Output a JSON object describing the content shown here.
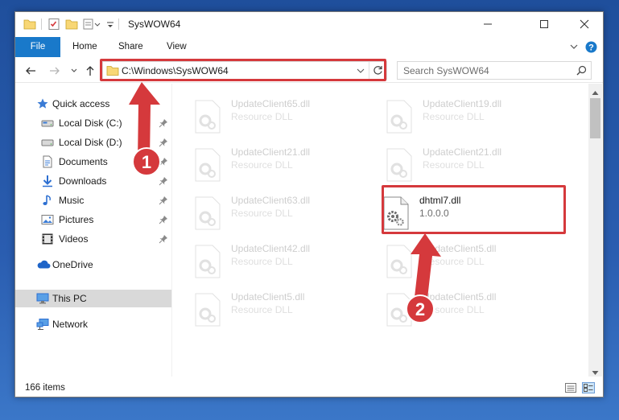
{
  "window": {
    "title": "SysWOW64",
    "minimize_glyph": "—",
    "maximize_glyph": "☐",
    "close_glyph": "✕"
  },
  "ribbon": {
    "tabs": [
      "File",
      "Home",
      "Share",
      "View"
    ],
    "expand_glyph": "⌄",
    "help_glyph": "?"
  },
  "address": {
    "path": "C:\\Windows\\SysWOW64",
    "search_placeholder": "Search SysWOW64"
  },
  "nav": {
    "items": [
      {
        "label": "Quick access",
        "icon": "star-icon"
      },
      {
        "label": "Local Disk (C:)",
        "icon": "drive-icon"
      },
      {
        "label": "Local Disk (D:)",
        "icon": "drive-icon"
      },
      {
        "label": "Documents",
        "icon": "documents-icon"
      },
      {
        "label": "Downloads",
        "icon": "download-icon"
      },
      {
        "label": "Music",
        "icon": "music-icon"
      },
      {
        "label": "Pictures",
        "icon": "pictures-icon"
      },
      {
        "label": "Videos",
        "icon": "videos-icon"
      },
      {
        "label": "OneDrive",
        "icon": "cloud-icon"
      },
      {
        "label": "This PC",
        "icon": "computer-icon"
      },
      {
        "label": "Network",
        "icon": "network-icon"
      }
    ]
  },
  "files": [
    {
      "name": "UpdateClient65.dll",
      "desc": "Resource DLL"
    },
    {
      "name": "UpdateClient19.dll",
      "desc": "Resource DLL"
    },
    {
      "name": "UpdateClient21.dll",
      "desc": "Resource DLL"
    },
    {
      "name": "UpdateClient21.dll",
      "desc": "Resource DLL"
    },
    {
      "name": "UpdateClient63.dll",
      "desc": "Resource DLL"
    },
    {
      "name": "dhtml7.dll",
      "desc": "1.0.0.0"
    },
    {
      "name": "UpdateClient42.dll",
      "desc": "Resource DLL"
    },
    {
      "name": "UpdateClient5.dll",
      "desc": "Resource DLL"
    },
    {
      "name": "UpdateClient5.dll",
      "desc": "Resource DLL"
    },
    {
      "name": "UpdateClient5.dll",
      "desc": "Resource DLL"
    }
  ],
  "status": {
    "item_count": "166 items"
  },
  "annotations": {
    "step1": "1",
    "step2": "2",
    "color": "#d5393c"
  },
  "colors": {
    "accent": "#1979ca",
    "folder": "#f8d775",
    "annotation_red": "#d5393c"
  }
}
